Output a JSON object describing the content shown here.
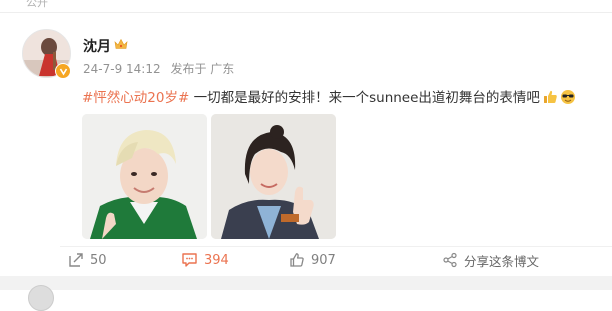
{
  "top": {
    "label": "公开"
  },
  "post": {
    "username": "沈月",
    "date": "24-7-9 14:12",
    "source": "发布于 广东",
    "hashtag": "#怦然心动20岁#",
    "text": " 一切都是最好的安排！来一个sunnee出道初舞台的表情吧",
    "emojis": [
      "thumbs-up-icon",
      "cool-sunglasses-icon"
    ]
  },
  "actions": {
    "repost": "50",
    "comment": "394",
    "like": "907",
    "share": "分享这条博文"
  },
  "colors": {
    "hashtag": "#eb7350",
    "meta": "#939393",
    "badge": "#f6a623"
  }
}
